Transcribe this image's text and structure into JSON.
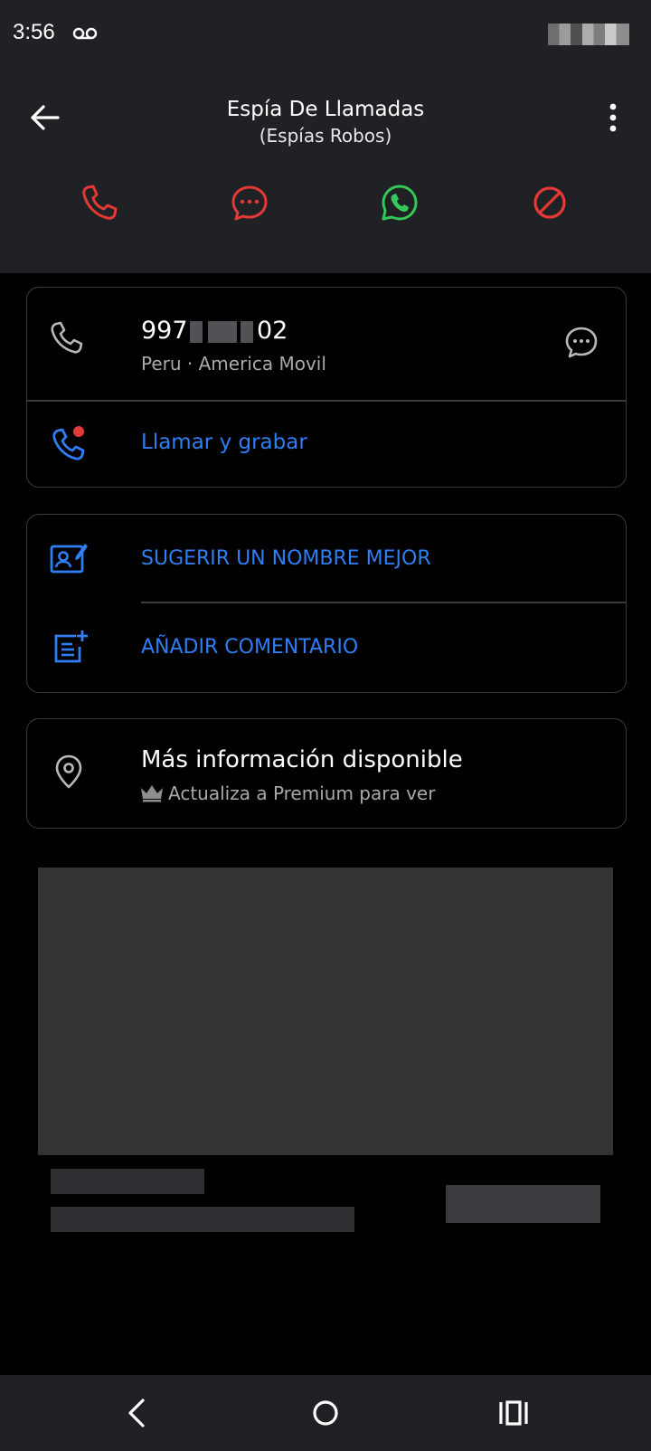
{
  "status_bar": {
    "time": "3:56",
    "voicemail_icon": "voicemail-icon"
  },
  "header": {
    "title": "Espía De Llamadas",
    "subtitle": "(Espías Robos)",
    "back_icon": "arrow-left-icon",
    "more_icon": "more-vertical-icon",
    "actions": [
      {
        "name": "call",
        "icon": "phone-icon",
        "color": "#e53935"
      },
      {
        "name": "message",
        "icon": "chat-bubble-icon",
        "color": "#e53935"
      },
      {
        "name": "whatsapp",
        "icon": "whatsapp-icon",
        "color": "#34c759"
      },
      {
        "name": "block",
        "icon": "block-icon",
        "color": "#e53935"
      }
    ]
  },
  "number_card": {
    "number_prefix": "997",
    "number_suffix": "02",
    "carrier": "Peru · America Movil",
    "record_label": "Llamar y grabar"
  },
  "options_card": {
    "suggest_label": "SUGERIR UN NOMBRE MEJOR",
    "comment_label": "AÑADIR COMENTARIO"
  },
  "info_card": {
    "title": "Más información disponible",
    "subtitle": "Actualiza a Premium para ver"
  },
  "colors": {
    "accent": "#2f7ef5",
    "header_bg": "#202124",
    "card_border": "#3c3c3e"
  }
}
